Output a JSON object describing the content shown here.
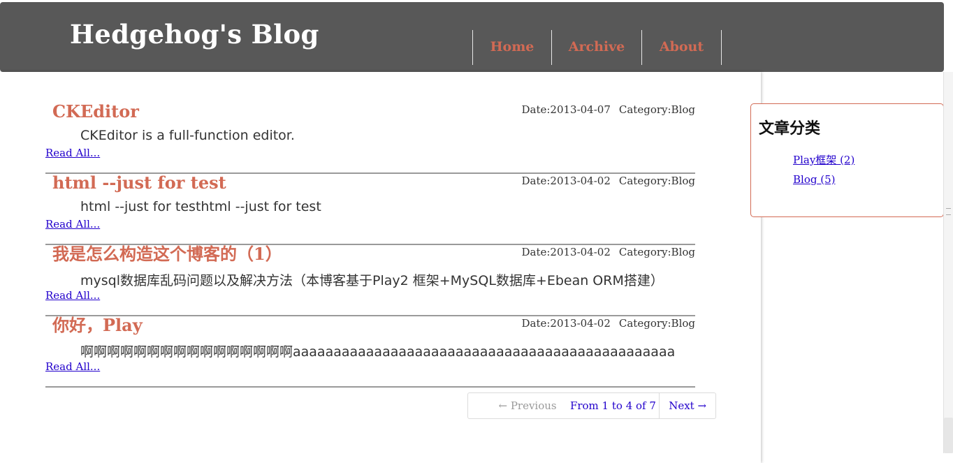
{
  "header": {
    "site_title": "Hedgehog's Blog",
    "nav": [
      "Home",
      "Archive",
      "About"
    ]
  },
  "posts": [
    {
      "title": "CKEditor",
      "date": "Date:2013-04-07",
      "category": "Category:Blog",
      "summary": "CKEditor is a full-function editor.",
      "read_all": "Read All..."
    },
    {
      "title": "html --just for test",
      "date": "Date:2013-04-02",
      "category": "Category:Blog",
      "summary": "html --just for testhtml --just for test",
      "read_all": "Read All..."
    },
    {
      "title": "我是怎么构造这个博客的（1）",
      "date": "Date:2013-04-02",
      "category": "Category:Blog",
      "summary": "mysql数据库乱码问题以及解决方法（本博客基于Play2 框架+MySQL数据库+Ebean ORM搭建）",
      "read_all": "Read All..."
    },
    {
      "title": "你好，Play",
      "date": "Date:2013-04-02",
      "category": "Category:Blog",
      "summary": "啊啊啊啊啊啊啊啊啊啊啊啊啊啊啊啊aaaaaaaaaaaaaaaaaaaaaaaaaaaaaaaaaaaaaaaaaaaaaaa",
      "read_all": "Read All..."
    }
  ],
  "pager": {
    "previous": "← Previous",
    "info": "From 1 to 4 of 7",
    "next": "Next →"
  },
  "sidebar": {
    "title": "文章分类",
    "categories": [
      "Play框架 (2)",
      "Blog (5)"
    ]
  },
  "colors": {
    "accent": "#d26a54",
    "header_bg": "#585858",
    "link": "#2200cc"
  }
}
